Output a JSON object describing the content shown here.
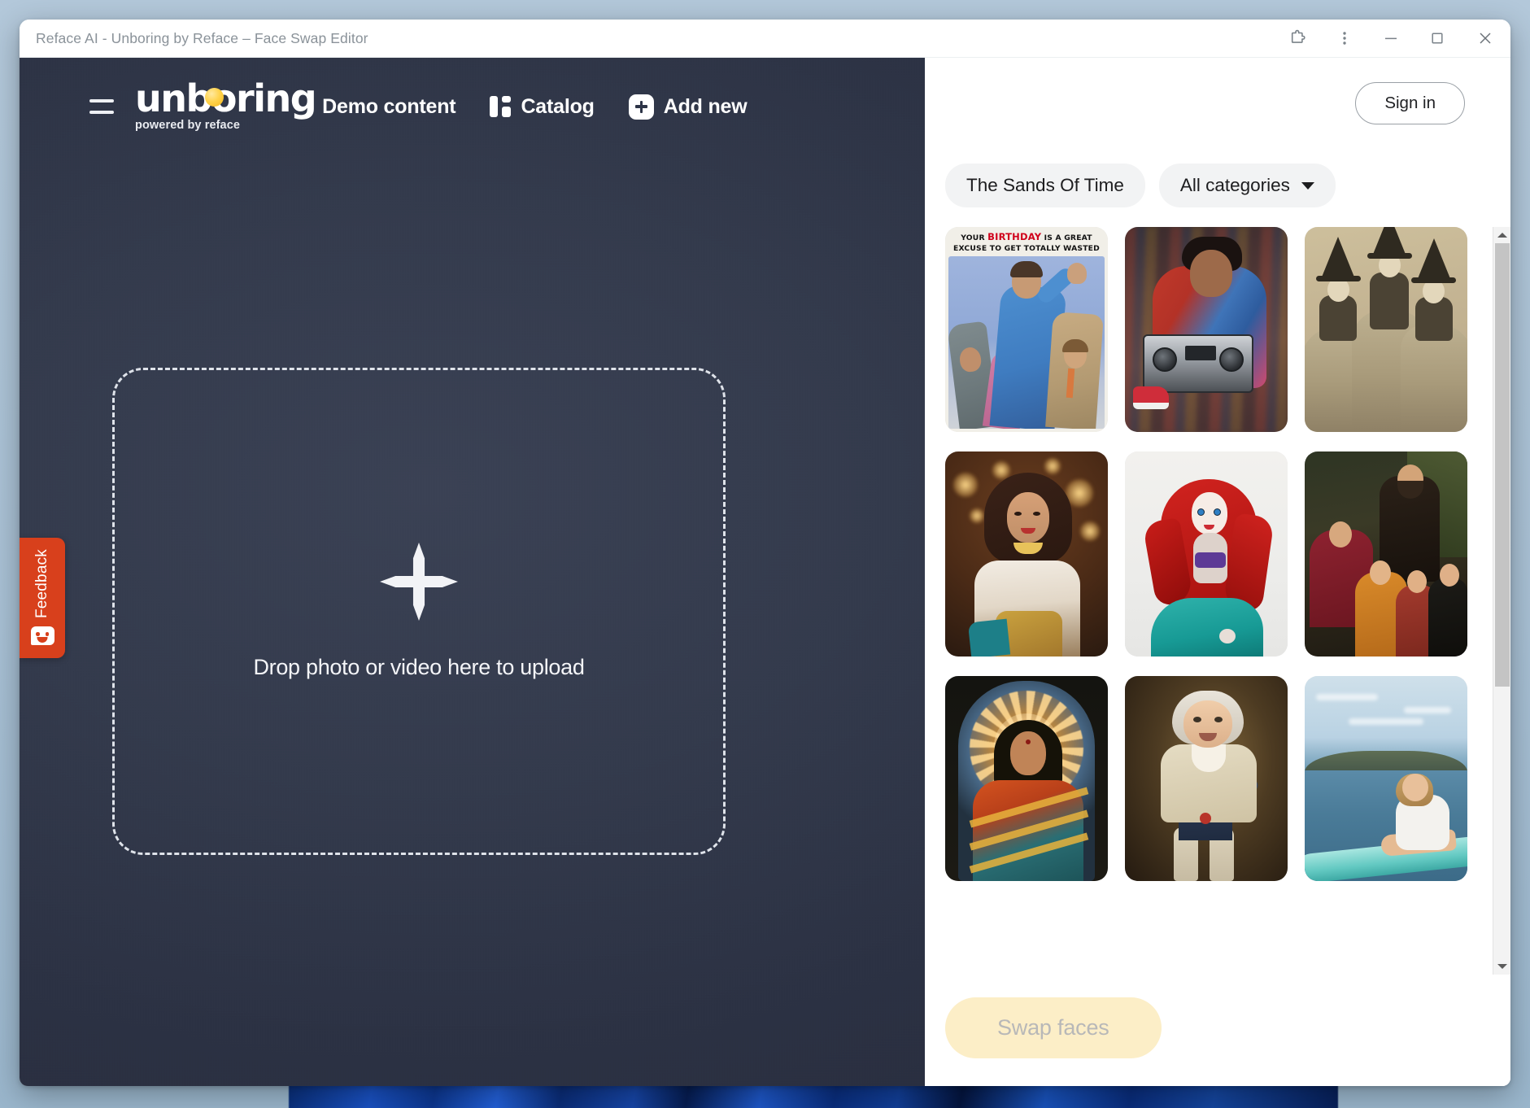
{
  "window": {
    "title": "Reface AI - Unboring by Reface – Face Swap Editor",
    "controls": [
      {
        "name": "extensions-icon",
        "label": "Extensions"
      },
      {
        "name": "more-menu-icon",
        "label": "More"
      },
      {
        "name": "minimize-button",
        "label": "Minimize"
      },
      {
        "name": "maximize-button",
        "label": "Maximize"
      },
      {
        "name": "close-button",
        "label": "Close"
      }
    ]
  },
  "header": {
    "menu_icon": "hamburger-menu-icon",
    "brand": {
      "wordmark": "unboring",
      "tagline": "powered by reface"
    },
    "nav": [
      {
        "label": "Demo content",
        "icon": null
      },
      {
        "label": "Catalog",
        "icon": "catalog-icon"
      },
      {
        "label": "Add new",
        "icon": "plus-icon"
      }
    ]
  },
  "editor": {
    "dropzone": {
      "label": "Drop photo or video here to upload",
      "icon": "plus-icon"
    }
  },
  "feedback": {
    "label": "Feedback",
    "icon": "smiley-face-icon",
    "color": "#d8401c"
  },
  "catalog": {
    "sign_in_label": "Sign in",
    "filters": [
      {
        "label": "The Sands Of Time",
        "has_chevron": false
      },
      {
        "label": "All categories",
        "has_chevron": true
      }
    ],
    "thumbnails": [
      {
        "id": "birthday-card",
        "alt": "Birthday card with three men in retro suits",
        "caption_line1_pre": "YOUR ",
        "caption_line1_highlight": "BIRTHDAY",
        "caption_line1_post": " IS A GREAT",
        "caption_line2": "EXCUSE TO GET TOTALLY WASTED"
      },
      {
        "id": "boombox-street",
        "alt": "Young man in colorful jacket holding a boombox"
      },
      {
        "id": "sepia-witches",
        "alt": "Vintage sepia photo of three women in witch hats"
      },
      {
        "id": "bollywood-dancer",
        "alt": "Woman in ornate Indian dance costume"
      },
      {
        "id": "mermaid-doll",
        "alt": "Red-haired mermaid doll figurine"
      },
      {
        "id": "classical-family",
        "alt": "Classical oil painting of a family portrait"
      },
      {
        "id": "goddess-shrine",
        "alt": "Woman in sari before a glowing halo shrine"
      },
      {
        "id": "baby-aristocrat",
        "alt": "Baby face on an 18th century aristocrat portrait"
      },
      {
        "id": "paddleboard-lake",
        "alt": "Woman kneeling on a paddleboard on a lake"
      }
    ],
    "scrollbar": {
      "thumb_position_percent": 0,
      "thumb_size_percent": 62
    },
    "swap_button_label": "Swap faces"
  }
}
